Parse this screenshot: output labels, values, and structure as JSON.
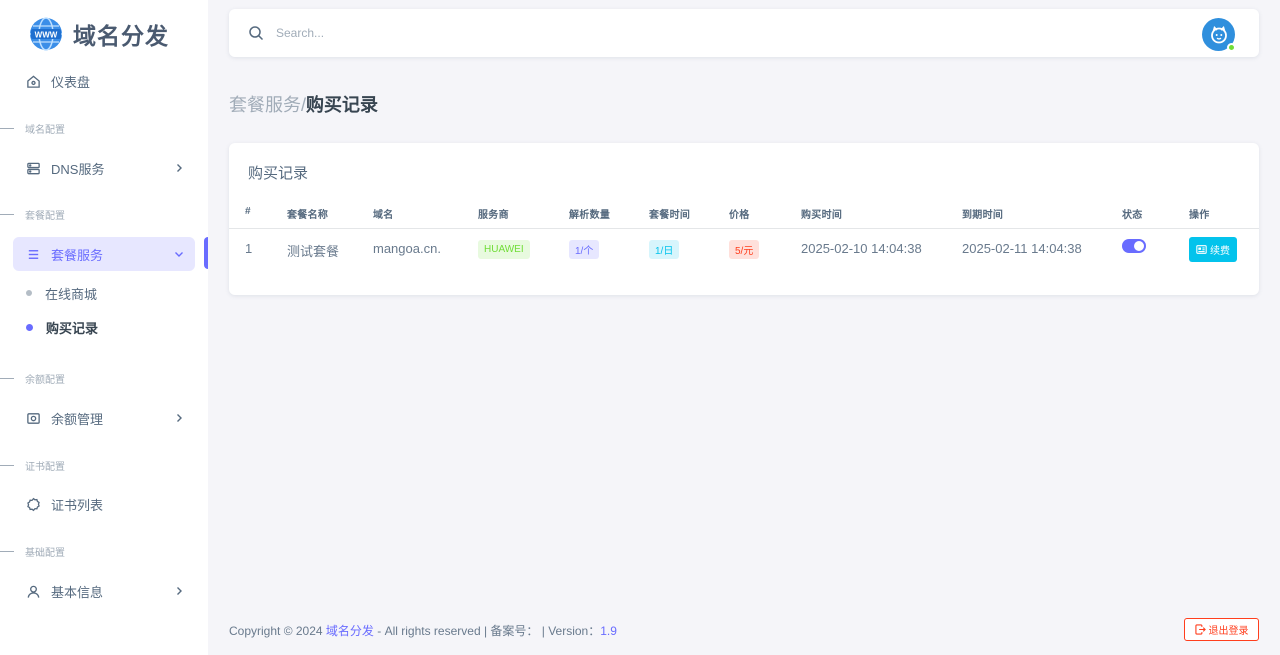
{
  "brand": {
    "name": "域名分发"
  },
  "sidebar": {
    "dashboard": "仪表盘",
    "headers": [
      "域名配置",
      "套餐配置",
      "余额配置",
      "证书配置",
      "基础配置"
    ],
    "dns": "DNS服务",
    "package_service": "套餐服务",
    "sub_items": [
      "在线商城",
      "购买记录"
    ],
    "balance": "余额管理",
    "cert_list": "证书列表",
    "basic_info": "基本信息"
  },
  "navbar": {
    "search_placeholder": "Search..."
  },
  "breadcrumb": {
    "parent": "套餐服务/",
    "current": "购买记录"
  },
  "card": {
    "title": "购买记录",
    "columns": [
      "#",
      "套餐名称",
      "域名",
      "服务商",
      "解析数量",
      "套餐时间",
      "价格",
      "购买时间",
      "到期时间",
      "状态",
      "操作"
    ],
    "rows": [
      {
        "index": "1",
        "package_name": "测试套餐",
        "domain": "mangoa.cn.",
        "provider": "HUAWEI",
        "resolve_count": "1/个",
        "package_time": "1/日",
        "price": "5/元",
        "purchase_time": "2025-02-10 14:04:38",
        "expire_time": "2025-02-11 14:04:38",
        "status_on": true,
        "action_label": "续费"
      }
    ]
  },
  "footer": {
    "copyright": "Copyright © 2024 ",
    "brand": "域名分发",
    "rights": " - All rights reserved | 备案号：  | Version：",
    "version": "1.9",
    "logout": "退出登录"
  },
  "colors": {
    "primary": "#696cff",
    "info": "#03c3ec",
    "success": "#71dd37",
    "danger": "#ff3e1d"
  }
}
